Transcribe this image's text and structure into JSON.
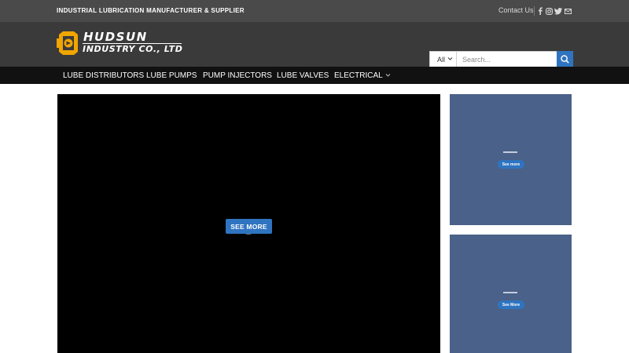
{
  "topbar": {
    "tagline": "INDUSTRIAL LUBRICATION MANUFACTURER & SUPPLIER",
    "contact_label": "Contact Us",
    "social_icons": [
      "facebook-icon",
      "instagram-icon",
      "twitter-icon",
      "email-icon"
    ]
  },
  "header": {
    "logo": {
      "line1": "HUDSUN",
      "line2": "INDUSTRY CO., LTD"
    },
    "search": {
      "category": "All",
      "placeholder": "Search...",
      "value": "",
      "button_icon": "search-icon"
    }
  },
  "nav": {
    "items": [
      {
        "label": "LUBE DISTRIBUTORS"
      },
      {
        "label": "LUBE PUMPS"
      },
      {
        "label": "PUMP INJECTORS"
      },
      {
        "label": "LUBE VALVES"
      },
      {
        "label": "ELECTRICAL",
        "has_dropdown": true
      }
    ]
  },
  "main": {
    "video": {
      "button_label": "SEE MORE"
    },
    "promos": [
      {
        "button_label": "See more"
      },
      {
        "button_label": "See More"
      }
    ]
  },
  "colors": {
    "topbar": "#4a4a4a",
    "header": "#3a3a3a",
    "nav": "#111111",
    "accent": "#2f74c0",
    "promo": "#4a6189",
    "logo_accent": "#f0a500"
  }
}
